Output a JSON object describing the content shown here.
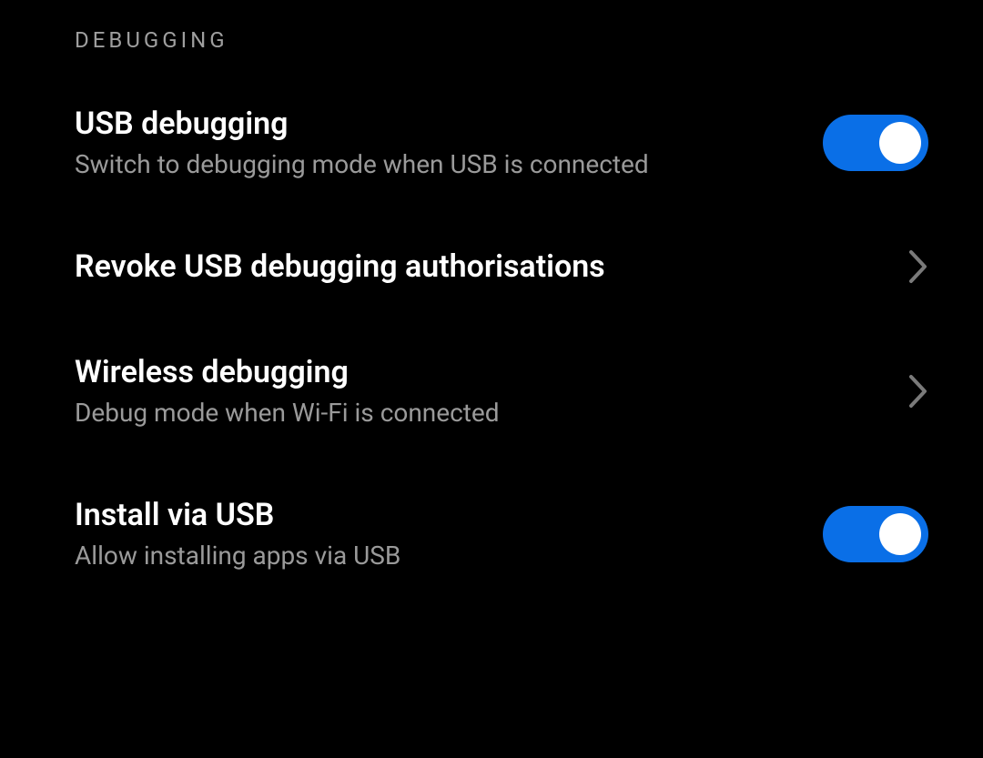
{
  "section": {
    "header": "DEBUGGING"
  },
  "items": [
    {
      "title": "USB debugging",
      "subtitle": "Switch to debugging mode when USB is connected",
      "control": "toggle",
      "state": "on"
    },
    {
      "title": "Revoke USB debugging authorisations",
      "subtitle": "",
      "control": "chevron"
    },
    {
      "title": "Wireless debugging",
      "subtitle": "Debug mode when Wi-Fi is connected",
      "control": "chevron"
    },
    {
      "title": "Install via USB",
      "subtitle": "Allow installing apps via USB",
      "control": "toggle",
      "state": "on"
    }
  ]
}
